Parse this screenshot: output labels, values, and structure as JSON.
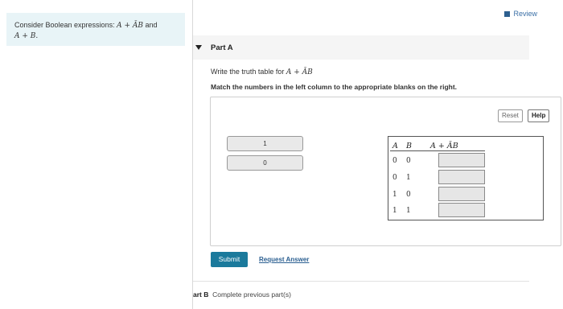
{
  "question": {
    "text_prefix": "Consider Boolean expressions: ",
    "expr1": "A + ĀB",
    "connector": " and",
    "expr2": "A + B."
  },
  "review": {
    "label": "Review"
  },
  "part_a": {
    "title": "Part A",
    "instruction_prefix": "Write the truth table for ",
    "instruction_expr": "A + ĀB",
    "match_instruction": "Match the numbers in the left column to the appropriate blanks on the right.",
    "buttons": {
      "reset": "Reset",
      "help": "Help"
    },
    "tiles": [
      "1",
      "0"
    ],
    "table": {
      "headers": [
        "A",
        "B",
        "A + ĀB"
      ],
      "rows": [
        [
          "0",
          "0",
          ""
        ],
        [
          "0",
          "1",
          ""
        ],
        [
          "1",
          "0",
          ""
        ],
        [
          "1",
          "1",
          ""
        ]
      ]
    },
    "submit": "Submit",
    "request_answer": "Request Answer"
  },
  "part_b": {
    "title": "art B",
    "status": "Complete previous part(s)"
  }
}
